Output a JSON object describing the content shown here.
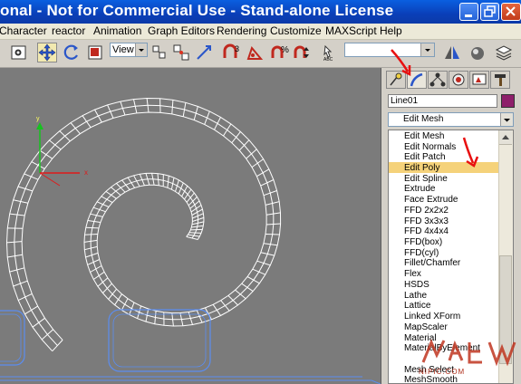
{
  "window": {
    "title": "onal - Not for Commercial Use - Stand-alone License"
  },
  "menu": {
    "items": [
      "Character",
      "reactor",
      "Animation",
      "Graph Editors",
      "Rendering",
      "Customize",
      "MAXScript",
      "Help"
    ]
  },
  "toolbar": {
    "view_dropdown": "View"
  },
  "command_panel": {
    "object_name": "Line01",
    "object_color": "#8e1f6a",
    "modifier_dropdown": "Edit Mesh",
    "modifier_list": [
      "Edit Mesh",
      "Edit Normals",
      "Edit Patch",
      "Edit Poly",
      "Edit Spline",
      "Extrude",
      "Face Extrude",
      "FFD 2x2x2",
      "FFD 3x3x3",
      "FFD 4x4x4",
      "FFD(box)",
      "FFD(cyl)",
      "Fillet/Chamfer",
      "Flex",
      "HSDS",
      "Lathe",
      "Lattice",
      "Linked XForm",
      "MapScaler",
      "Material",
      "MaterialByElement",
      "Mesh Select",
      "MeshSmooth"
    ],
    "highlighted_item": "Edit Poly"
  },
  "colors": {
    "titlebar": "#0a49c8",
    "viewport_bg": "#7b7b7b",
    "wire": "#ffffff",
    "blue_wire": "#5b8df0",
    "annotation_red": "#e81010",
    "highlight": "#f5d27a"
  },
  "watermark": {
    "url": "NIPIC.COM"
  }
}
